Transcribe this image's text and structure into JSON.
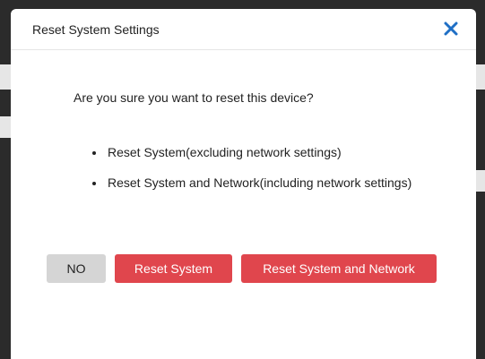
{
  "dialog": {
    "title": "Reset System Settings",
    "close_icon": "close-icon",
    "question": "Are you sure you want to reset this device?",
    "options": [
      "Reset System(excluding network settings)",
      "Reset System and Network(including network settings)"
    ],
    "buttons": {
      "no": "NO",
      "reset_system": "Reset System",
      "reset_system_network": "Reset System and Network"
    }
  },
  "colors": {
    "accent_danger": "#e0464d",
    "close_icon": "#1f6fc5",
    "neutral_button": "#d5d5d5",
    "backdrop": "#2b2b2b"
  }
}
